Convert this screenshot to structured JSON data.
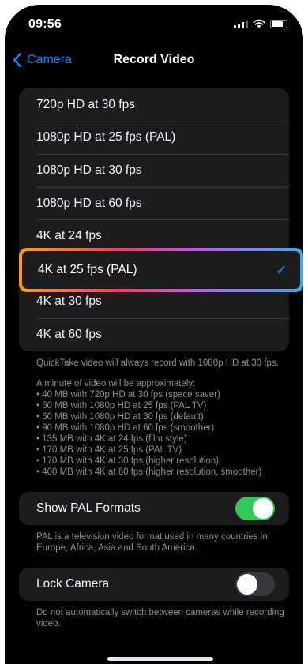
{
  "status": {
    "time": "09:56"
  },
  "nav": {
    "back_label": "Camera",
    "title": "Record Video"
  },
  "record_options": [
    {
      "label": "720p HD at 30 fps"
    },
    {
      "label": "1080p HD at 25 fps (PAL)"
    },
    {
      "label": "1080p HD at 30 fps"
    },
    {
      "label": "1080p HD at 60 fps"
    },
    {
      "label": "4K at 24 fps"
    },
    {
      "label": "4K at 25 fps (PAL)",
      "selected": true
    },
    {
      "label": "4K at 30 fps"
    },
    {
      "label": "4K at 60 fps"
    }
  ],
  "selected_index": 5,
  "checkmark": "✓",
  "quicktake_note": "QuickTake video will always record with 1080p HD at 30 fps.",
  "size_intro": "A minute of video will be approximately:",
  "size_list": [
    "• 40 MB with 720p HD at 30 fps (space saver)",
    "• 60 MB with 1080p HD at 25 fps (PAL TV)",
    "• 60 MB with 1080p HD at 30 fps (default)",
    "• 90 MB with 1080p HD at 60 fps (smoother)",
    "• 135 MB with 4K at 24 fps (film style)",
    "• 170 MB with 4K at 25 fps (PAL TV)",
    "• 170 MB with 4K at 30 fps (higher resolution)",
    "• 400 MB with 4K at 60 fps (higher resolution, smoother)"
  ],
  "pal_formats": {
    "label": "Show PAL Formats",
    "enabled": true,
    "note": "PAL is a television video format used in many countries in Europe, Africa, Asia and South America."
  },
  "lock_camera": {
    "label": "Lock Camera",
    "enabled": false,
    "note": "Do not automatically switch between cameras while recording video."
  },
  "colors": {
    "accent": "#0a84ff",
    "toggle_on": "#34c759",
    "background": "#000000",
    "cell": "#1c1c1e"
  }
}
